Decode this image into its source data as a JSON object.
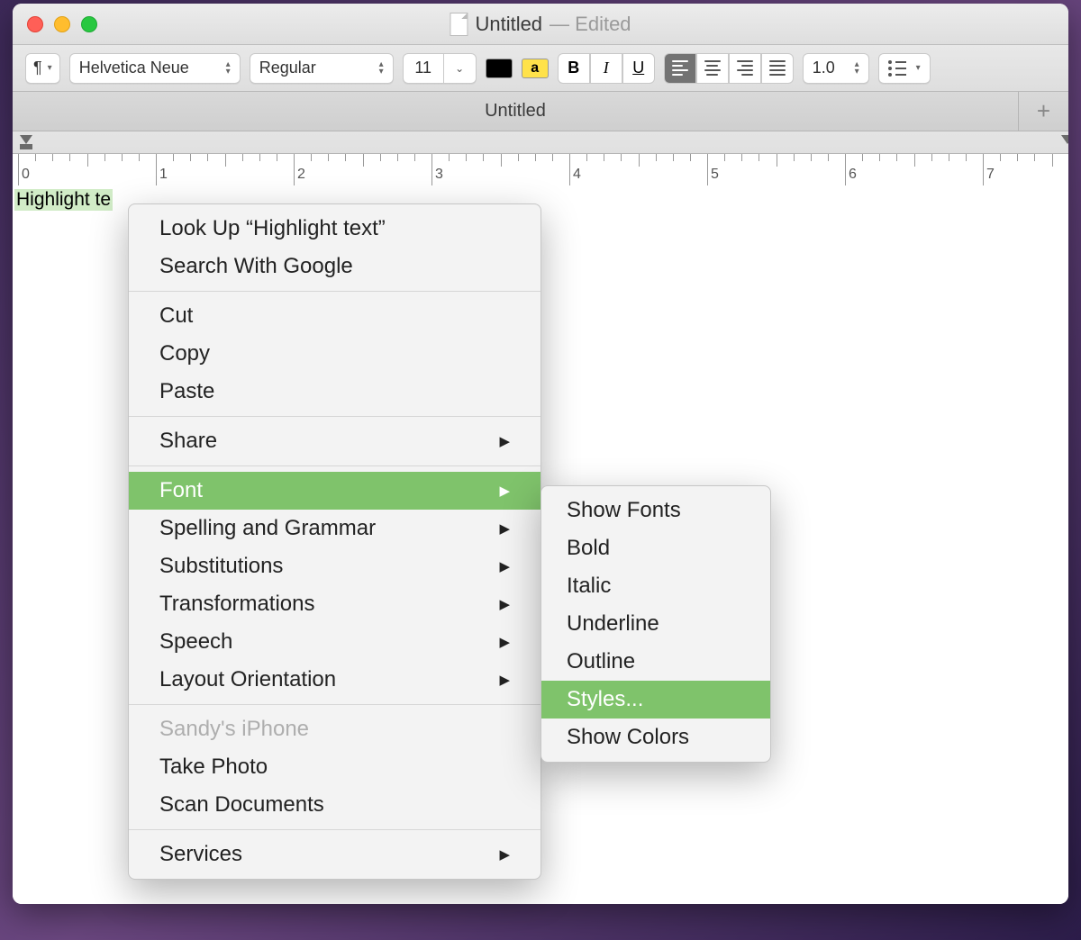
{
  "titlebar": {
    "doc_name": "Untitled",
    "edited_suffix": "— Edited"
  },
  "toolbar": {
    "pilcrow": "¶",
    "font_family": "Helvetica Neue",
    "font_style": "Regular",
    "font_size": "11",
    "highlight_sample": "a",
    "bold": "B",
    "italic": "I",
    "underline": "U",
    "line_spacing": "1.0"
  },
  "tab": {
    "label": "Untitled"
  },
  "ruler": {
    "numbers": [
      "0",
      "1",
      "2",
      "3",
      "4",
      "5",
      "6",
      "7"
    ]
  },
  "document": {
    "highlighted_text": "Highlight te"
  },
  "context_menu": {
    "lookup": "Look Up “Highlight text”",
    "search_google": "Search With Google",
    "cut": "Cut",
    "copy": "Copy",
    "paste": "Paste",
    "share": "Share",
    "font": "Font",
    "spelling": "Spelling and Grammar",
    "substitutions": "Substitutions",
    "transformations": "Transformations",
    "speech": "Speech",
    "layout_orientation": "Layout Orientation",
    "sandys_iphone": "Sandy's iPhone",
    "take_photo": "Take Photo",
    "scan_documents": "Scan Documents",
    "services": "Services"
  },
  "font_submenu": {
    "show_fonts": "Show Fonts",
    "bold": "Bold",
    "italic": "Italic",
    "underline": "Underline",
    "outline": "Outline",
    "styles": "Styles...",
    "show_colors": "Show Colors"
  }
}
